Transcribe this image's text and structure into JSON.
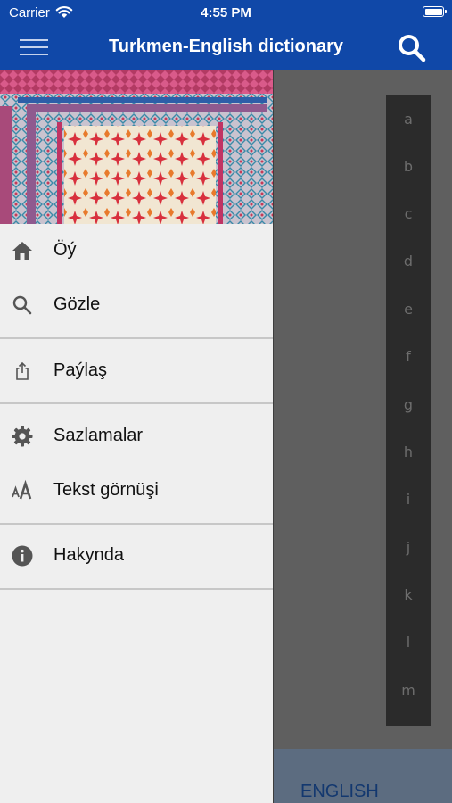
{
  "status_bar": {
    "carrier": "Carrier",
    "time": "4:55 PM"
  },
  "nav_bar": {
    "title": "Turkmen-English dictionary"
  },
  "drawer": {
    "items": [
      {
        "label": "Öý",
        "icon": "home-icon"
      },
      {
        "label": "Gözle",
        "icon": "search-icon"
      },
      {
        "label": "Paýlaş",
        "icon": "share-icon"
      },
      {
        "label": "Sazlamalar",
        "icon": "gear-icon"
      },
      {
        "label": "Tekst görnüşi",
        "icon": "text-size-icon"
      },
      {
        "label": "Hakynda",
        "icon": "info-icon"
      }
    ]
  },
  "alphabet_index": [
    "a",
    "b",
    "c",
    "d",
    "e",
    "f",
    "g",
    "h",
    "i",
    "j",
    "k",
    "l",
    "m"
  ],
  "bottom": {
    "language_label": "ENGLISH"
  },
  "colors": {
    "brand": "#1048a8",
    "drawer_bg": "#efefef",
    "overlay": "#5f5f5f",
    "index_bg": "#2b2b2b"
  }
}
